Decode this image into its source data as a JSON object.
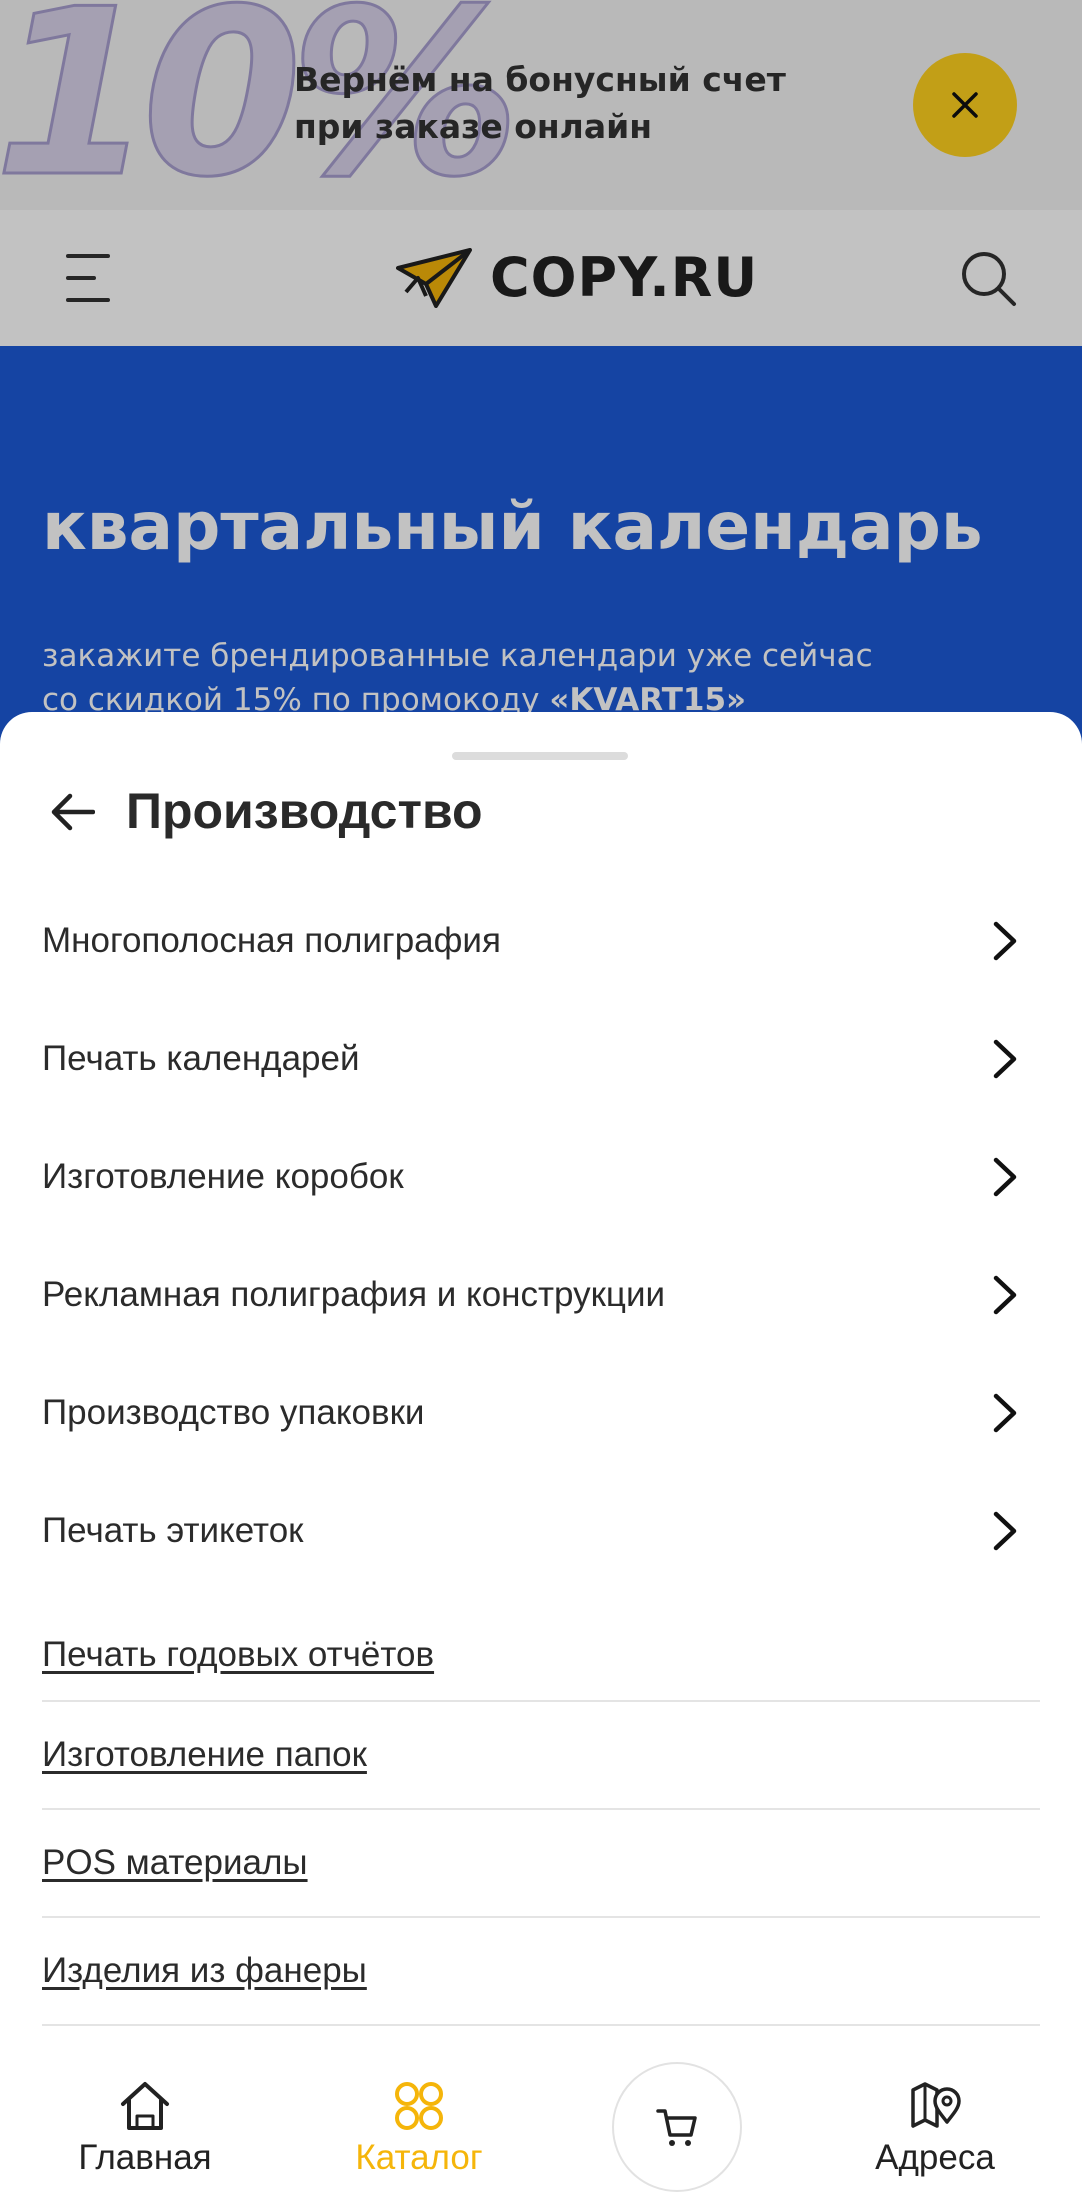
{
  "promo": {
    "big_text": "10%",
    "text_line1": "Вернём на бонусный счет",
    "text_line2": "при заказе онлайн",
    "close_icon": "close-icon",
    "close_color": "#ffd21f"
  },
  "header": {
    "menu_icon": "hamburger-menu-icon",
    "logo_text": "COPY.RU",
    "search_icon": "search-icon"
  },
  "hero": {
    "title": "квартальный календарь",
    "subtitle_line1": "закажите брендированные календари уже сейчас",
    "subtitle_line2_prefix": "со скидкой 15% по промокоду ",
    "promo_code": "«KVART15»",
    "background": "#1c5ad6"
  },
  "sheet": {
    "back_icon": "arrow-left-icon",
    "title": "Производство",
    "categories": [
      {
        "label": "Многополосная полиграфия"
      },
      {
        "label": "Печать календарей"
      },
      {
        "label": "Изготовление коробок"
      },
      {
        "label": "Рекламная полиграфия и конструкции"
      },
      {
        "label": "Производство упаковки"
      },
      {
        "label": "Печать этикеток"
      }
    ],
    "links": [
      {
        "label": "Печать годовых отчётов"
      },
      {
        "label": "Изготовление папок"
      },
      {
        "label": "POS материалы"
      },
      {
        "label": "Изделия из фанеры"
      }
    ]
  },
  "bottom_nav": {
    "home": "Главная",
    "catalog": "Каталог",
    "addresses": "Адреса",
    "cart_icon": "cart-icon",
    "accent": "#f5b50a"
  }
}
